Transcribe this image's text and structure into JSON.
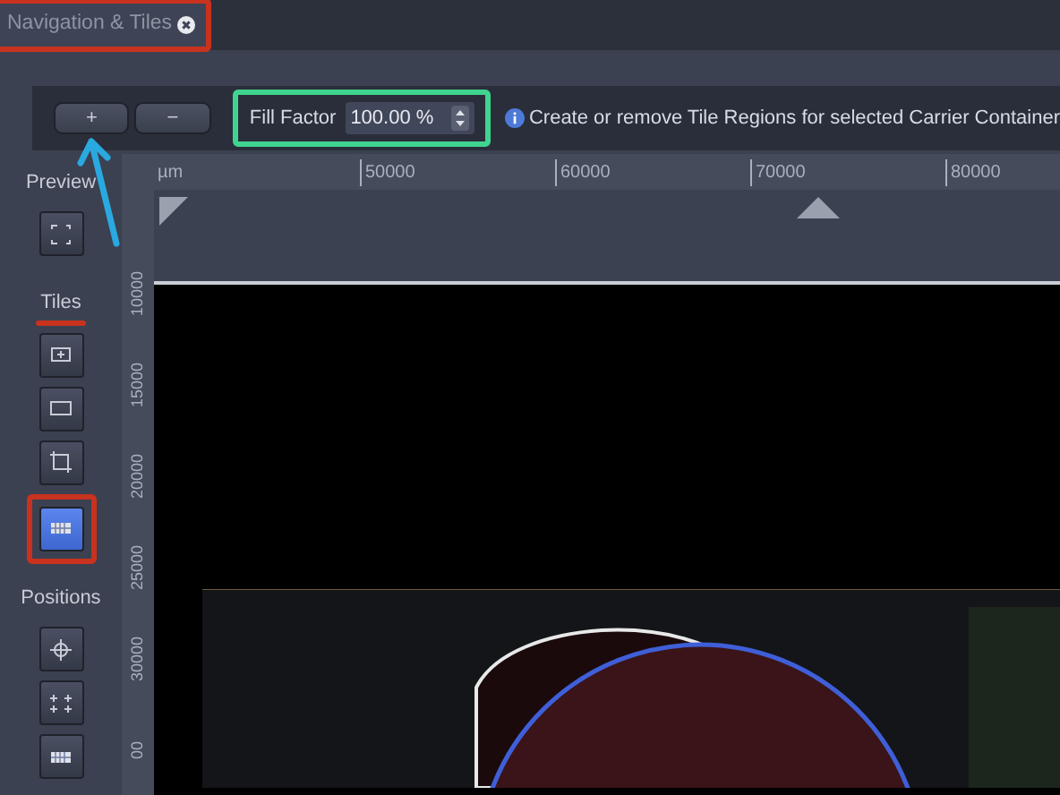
{
  "tab": {
    "title": "Navigation & Tiles",
    "highlighted": true
  },
  "toolbar": {
    "buttons": [
      {
        "label": "+",
        "pointed_at": true
      },
      {
        "label": "−",
        "pointed_at": false
      }
    ],
    "fill_factor": {
      "label": "Fill Factor",
      "value": "100.00 %",
      "highlighted": true
    },
    "info": "Create or remove Tile Regions for selected Carrier Container"
  },
  "ruler": {
    "unit": "µm",
    "x_labels": [
      "50000",
      "60000",
      "70000",
      "80000"
    ],
    "y_labels": [
      "10000",
      "15000",
      "20000",
      "25000",
      "30000",
      "00"
    ]
  },
  "sidebar": [
    {
      "title": "Preview",
      "underlined": false,
      "buttons": [
        {
          "kind": "frame",
          "selected": false,
          "highlighted": false
        }
      ]
    },
    {
      "title": "Tiles",
      "underlined": true,
      "buttons": [
        {
          "kind": "add",
          "selected": false,
          "highlighted": false
        },
        {
          "kind": "rect",
          "selected": false,
          "highlighted": false
        },
        {
          "kind": "crop",
          "selected": false,
          "highlighted": false
        },
        {
          "kind": "grid",
          "selected": true,
          "highlighted": true
        }
      ]
    },
    {
      "title": "Positions",
      "underlined": false,
      "buttons": [
        {
          "kind": "crosshair",
          "selected": false,
          "highlighted": false
        },
        {
          "kind": "multi",
          "selected": false,
          "highlighted": false
        },
        {
          "kind": "grid",
          "selected": false,
          "highlighted": false
        }
      ]
    }
  ]
}
